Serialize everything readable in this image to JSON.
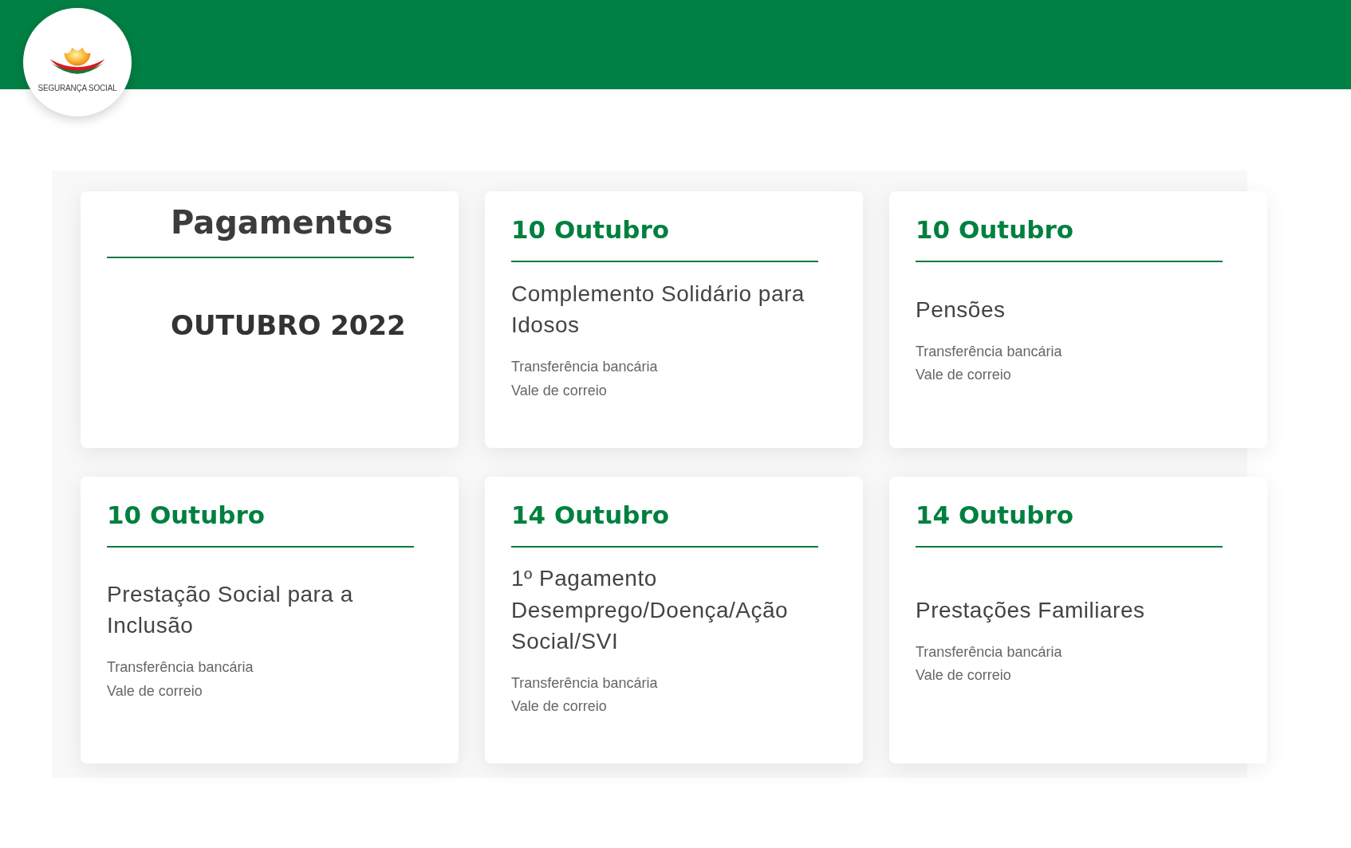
{
  "header": {
    "logo_text": "SEGURANÇA SOCIAL"
  },
  "intro": {
    "title": "Pagamentos",
    "subtitle": "OUTUBRO 2022"
  },
  "cards": [
    {
      "date": "10 Outubro",
      "title": "Complemento Solidário para Idosos",
      "methods": [
        "Transferência bancária",
        "Vale de correio"
      ]
    },
    {
      "date": "10 Outubro",
      "title": "Pensões",
      "methods": [
        "Transferência bancária",
        "Vale de correio"
      ]
    },
    {
      "date": "10 Outubro",
      "title": "Prestação Social para a Inclusão",
      "methods": [
        "Transferência bancária",
        "Vale de correio"
      ]
    },
    {
      "date": "14 Outubro",
      "title": "1º Pagamento Desemprego/Doença/Ação Social/SVI",
      "methods": [
        "Transferência bancária",
        "Vale de correio"
      ]
    },
    {
      "date": "14 Outubro",
      "title": "Prestações Familiares",
      "methods": [
        "Transferência bancária",
        "Vale de correio"
      ]
    }
  ]
}
